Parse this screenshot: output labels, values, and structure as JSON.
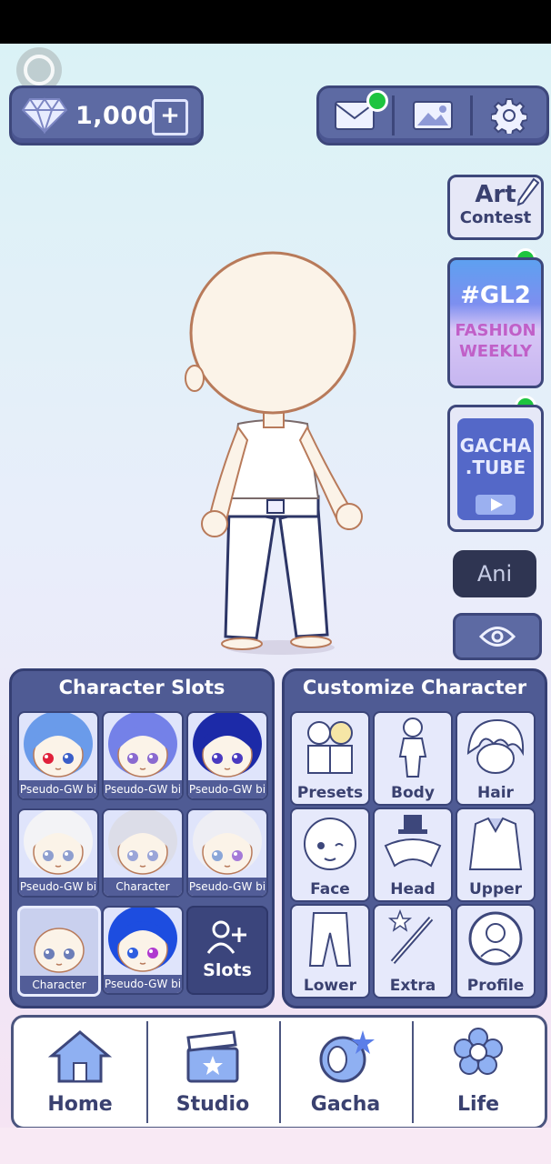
{
  "currency": {
    "gems": "1,000"
  },
  "side": {
    "art_contest": {
      "line1": "Art",
      "line2": "Contest"
    },
    "fashion": {
      "title": "#GL2",
      "line1": "FASHION",
      "line2": "WEEKLY"
    },
    "gacha_tube": {
      "line1": "GACHA",
      "line2": ".TUBE"
    },
    "ani_label": "Ani"
  },
  "character_slots": {
    "title": "Character Slots",
    "slots": [
      {
        "label": "Pseudo-GW bi",
        "hair": "#6a9bea",
        "eyes": [
          "#e0203a",
          "#3a5ec8"
        ]
      },
      {
        "label": "Pseudo-GW bi",
        "hair": "#7481e8",
        "eyes": [
          "#8a6ad0",
          "#8a6ad0"
        ]
      },
      {
        "label": "Pseudo-GW bi",
        "hair": "#1c2aa8",
        "eyes": [
          "#4a3ac0",
          "#4a3ac0"
        ]
      },
      {
        "label": "Pseudo-GW bi",
        "hair": "#f3f3f6",
        "eyes": [
          "#8e9ecf",
          "#8e9ecf"
        ]
      },
      {
        "label": "Character",
        "hair": "#dcdde8",
        "eyes": [
          "#9aa5d8",
          "#9aa5d8"
        ]
      },
      {
        "label": "Pseudo-GW bi",
        "hair": "#eeeef4",
        "eyes": [
          "#8aa6d8",
          "#a57ad8"
        ]
      },
      {
        "label": "Character",
        "hair": "none",
        "eyes": [
          "#6b7db8",
          "#6b7db8"
        ]
      },
      {
        "label": "Pseudo-GW bi",
        "hair": "#1d4de0",
        "eyes": [
          "#2f5fe0",
          "#b03ad0"
        ]
      }
    ],
    "add_label": "Slots"
  },
  "customize": {
    "title": "Customize Character",
    "items": [
      "Presets",
      "Body",
      "Hair",
      "Face",
      "Head",
      "Upper",
      "Lower",
      "Extra",
      "Profile"
    ]
  },
  "nav": {
    "items": [
      "Home",
      "Studio",
      "Gacha",
      "Life"
    ]
  },
  "colors": {
    "panel": "#4f5b94",
    "border": "#353f73",
    "accent_green": "#1ec43f"
  }
}
